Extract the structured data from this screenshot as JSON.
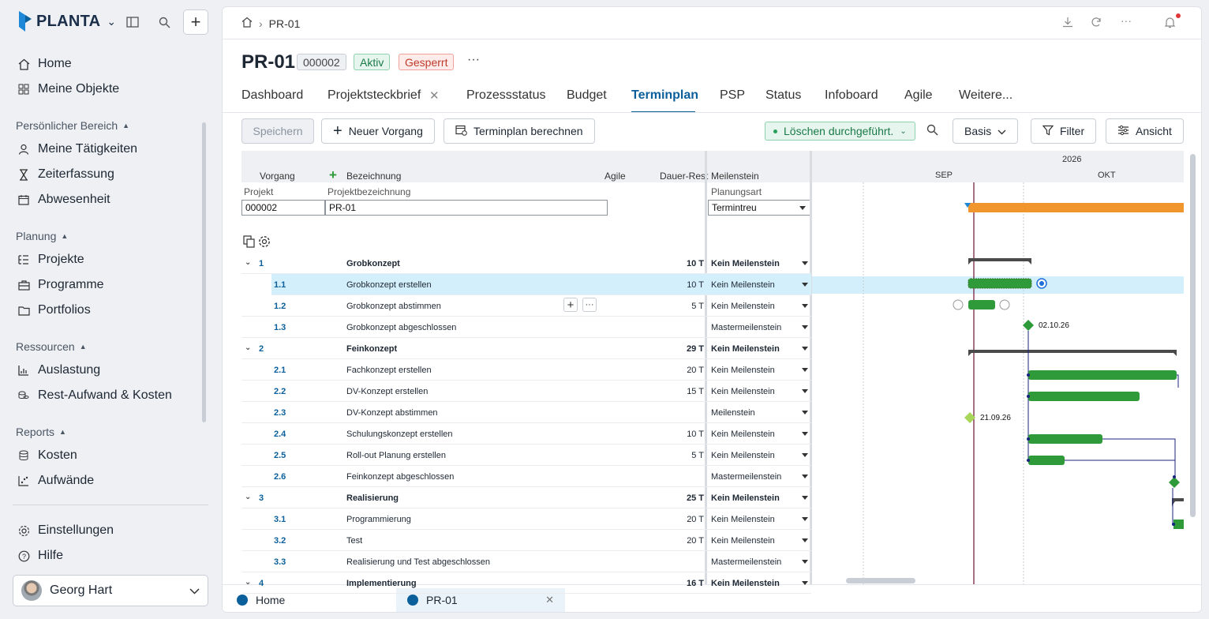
{
  "brand": {
    "name": "PLANTA"
  },
  "sidebar": {
    "home": "Home",
    "meine_objekte": "Meine Objekte",
    "sec_persoenlich": "Persönlicher Bereich",
    "taetigkeiten": "Meine Tätigkeiten",
    "zeiterfassung": "Zeiterfassung",
    "abwesenheit": "Abwesenheit",
    "sec_planung": "Planung",
    "projekte": "Projekte",
    "programme": "Programme",
    "portfolios": "Portfolios",
    "sec_ressourcen": "Ressourcen",
    "auslastung": "Auslastung",
    "rest": "Rest-Aufwand & Kosten",
    "sec_reports": "Reports",
    "kosten": "Kosten",
    "aufwaende": "Aufwände",
    "einstellungen": "Einstellungen",
    "hilfe": "Hilfe",
    "user": "Georg Hart"
  },
  "breadcrumb": {
    "current": "PR-01"
  },
  "header": {
    "title": "PR-01",
    "id_badge": "000002",
    "status_aktiv": "Aktiv",
    "status_gesperrt": "Gesperrt",
    "more": "···"
  },
  "tabs": {
    "dashboard": "Dashboard",
    "steckbrief": "Projektsteckbrief",
    "prozess": "Prozessstatus",
    "budget": "Budget",
    "terminplan": "Terminplan",
    "psp": "PSP",
    "status": "Status",
    "infoboard": "Infoboard",
    "agile": "Agile",
    "weitere": "Weitere..."
  },
  "toolbar": {
    "speichern": "Speichern",
    "neuer_vorgang": "Neuer Vorgang",
    "berechnen": "Terminplan berechnen",
    "status_msg": "Löschen durchgeführt.",
    "basis": "Basis",
    "filter": "Filter",
    "ansicht": "Ansicht"
  },
  "grid": {
    "col_vorgang": "Vorgang",
    "col_bezeichnung": "Bezeichnung",
    "col_agile": "Agile",
    "col_dauer": "Dauer-Rest",
    "col_meilenstein": "Meilenstein",
    "sub_projekt": "Projekt",
    "sub_bez": "Projektbezeichnung",
    "sub_planungsart": "Planungsart",
    "projekt_value": "000002",
    "bez_value": "PR-01",
    "planungsart_value": "Termintreu",
    "year": "2026",
    "month_sep": "SEP",
    "month_okt": "OKT",
    "rows": [
      {
        "num": "1",
        "name": "Grobkonzept",
        "dur": "10 T",
        "ms": "Kein Meilenstein",
        "group": true
      },
      {
        "num": "1.1",
        "name": "Grobkonzept erstellen",
        "dur": "10 T",
        "ms": "Kein Meilenstein"
      },
      {
        "num": "1.2",
        "name": "Grobkonzept abstimmen",
        "dur": "5 T",
        "ms": "Kein Meilenstein"
      },
      {
        "num": "1.3",
        "name": "Grobkonzept abgeschlossen",
        "dur": "",
        "ms": "Mastermeilenstein"
      },
      {
        "num": "2",
        "name": "Feinkonzept",
        "dur": "29 T",
        "ms": "Kein Meilenstein",
        "group": true
      },
      {
        "num": "2.1",
        "name": "Fachkonzept erstellen",
        "dur": "20 T",
        "ms": "Kein Meilenstein"
      },
      {
        "num": "2.2",
        "name": "DV-Konzept erstellen",
        "dur": "15 T",
        "ms": "Kein Meilenstein"
      },
      {
        "num": "2.3",
        "name": "DV-Konzept abstimmen",
        "dur": "",
        "ms": "Meilenstein"
      },
      {
        "num": "2.4",
        "name": "Schulungskonzept erstellen",
        "dur": "10 T",
        "ms": "Kein Meilenstein"
      },
      {
        "num": "2.5",
        "name": "Roll-out Planung erstellen",
        "dur": "5 T",
        "ms": "Kein Meilenstein"
      },
      {
        "num": "2.6",
        "name": "Feinkonzept abgeschlossen",
        "dur": "",
        "ms": "Mastermeilenstein"
      },
      {
        "num": "3",
        "name": "Realisierung",
        "dur": "25 T",
        "ms": "Kein Meilenstein",
        "group": true
      },
      {
        "num": "3.1",
        "name": "Programmierung",
        "dur": "20 T",
        "ms": "Kein Meilenstein"
      },
      {
        "num": "3.2",
        "name": "Test",
        "dur": "20 T",
        "ms": "Kein Meilenstein"
      },
      {
        "num": "3.3",
        "name": "Realisierung und Test abgeschlossen",
        "dur": "",
        "ms": "Mastermeilenstein"
      },
      {
        "num": "4",
        "name": "Implementierung",
        "dur": "16 T",
        "ms": "Kein Meilenstein",
        "group": true
      }
    ],
    "ms_label_13": "02.10.26",
    "ms_label_23": "21.09.26"
  },
  "bottom_tabs": {
    "home": "Home",
    "pr01": "PR-01"
  },
  "colors": {
    "accent": "#0b5f9a",
    "bar_green": "#2e9a3a",
    "bar_orange": "#f0962c",
    "summary": "#4a4a4a"
  }
}
